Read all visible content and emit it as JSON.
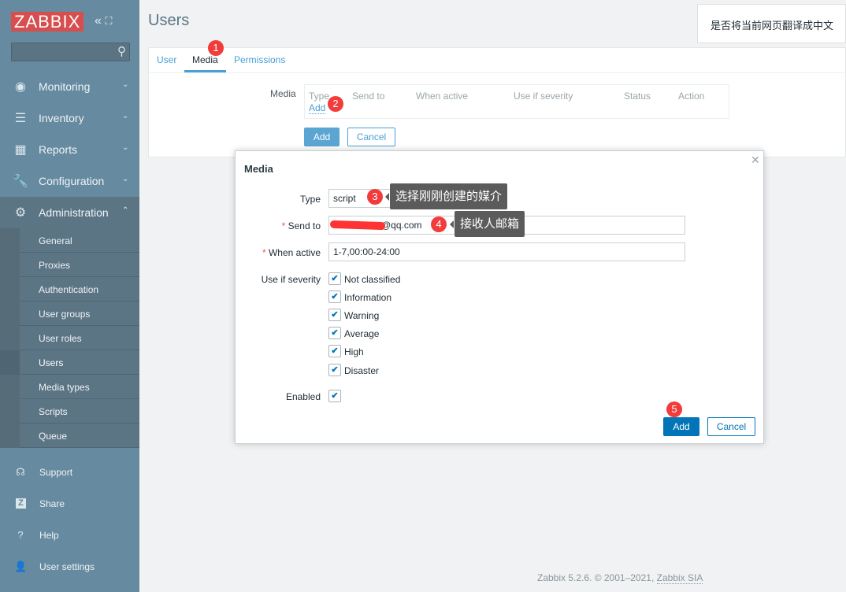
{
  "brand": {
    "logo": "ZABBIX",
    "collapse_icon": "double-chevron-left",
    "kiosk_icon": "expand"
  },
  "sidebar": {
    "search_placeholder": "",
    "menu": [
      {
        "label": "Monitoring",
        "icon": "eye"
      },
      {
        "label": "Inventory",
        "icon": "list"
      },
      {
        "label": "Reports",
        "icon": "bar-chart"
      },
      {
        "label": "Configuration",
        "icon": "wrench"
      },
      {
        "label": "Administration",
        "icon": "gear",
        "expanded": true
      }
    ],
    "submenu": [
      "General",
      "Proxies",
      "Authentication",
      "User groups",
      "User roles",
      "Users",
      "Media types",
      "Scripts",
      "Queue"
    ],
    "current": "Users",
    "bottom": [
      {
        "label": "Support",
        "icon": "headset"
      },
      {
        "label": "Share",
        "icon": "z-square"
      },
      {
        "label": "Help",
        "icon": "question"
      },
      {
        "label": "User settings",
        "icon": "user"
      }
    ]
  },
  "header": {
    "title": "Users"
  },
  "translate_prompt": "是否将当前网页翻译成中文",
  "tabs": [
    {
      "label": "User"
    },
    {
      "label": "Media",
      "active": true
    },
    {
      "label": "Permissions"
    }
  ],
  "media_form": {
    "label": "Media",
    "columns": [
      "Type",
      "Send to",
      "When active",
      "Use if severity",
      "Status",
      "Action"
    ],
    "add_link": "Add",
    "add_button": "Add",
    "cancel_button": "Cancel"
  },
  "modal": {
    "title": "Media",
    "type_label": "Type",
    "type_value": "script",
    "send_to_label": "Send to",
    "send_to_value": "@qq.com",
    "when_active_label": "When active",
    "when_active_value": "1-7,00:00-24:00",
    "severity_label": "Use if severity",
    "severities": [
      {
        "label": "Not classified",
        "checked": true
      },
      {
        "label": "Information",
        "checked": true
      },
      {
        "label": "Warning",
        "checked": true
      },
      {
        "label": "Average",
        "checked": true
      },
      {
        "label": "High",
        "checked": true
      },
      {
        "label": "Disaster",
        "checked": true
      }
    ],
    "enabled_label": "Enabled",
    "enabled": true,
    "add_button": "Add",
    "cancel_button": "Cancel",
    "required_mark": "*"
  },
  "annotations": {
    "badges": [
      "1",
      "2",
      "3",
      "4",
      "5"
    ],
    "tip3": "选择刚刚创建的媒介",
    "tip4": "接收人邮箱",
    "badge_color": "#f23b3b"
  },
  "footer": {
    "text": "Zabbix 5.2.6. © 2001–2021, ",
    "link": "Zabbix SIA"
  }
}
